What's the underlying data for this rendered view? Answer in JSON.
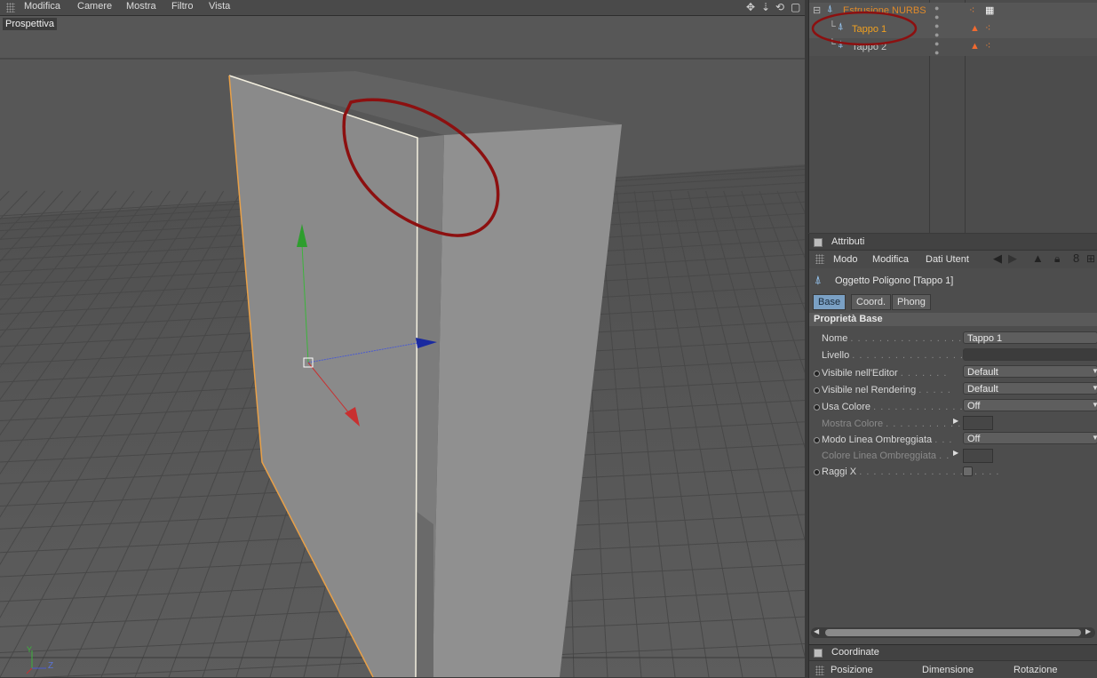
{
  "viewport": {
    "menu": [
      "Modifica",
      "Camere",
      "Mostra",
      "Filtro",
      "Vista"
    ],
    "view_label": "Prospettiva",
    "axis_labels": {
      "y": "Y",
      "z": "Z"
    }
  },
  "object_manager": {
    "objects": [
      {
        "name": "Estrusione NURBS",
        "selected": false,
        "color": "#e08a2a"
      },
      {
        "name": "Tappo 1",
        "selected": true,
        "color": "#f0a020"
      },
      {
        "name": "Tappo 2",
        "selected": false,
        "color": "#c8c8c8"
      }
    ]
  },
  "attributes": {
    "panel_title": "Attributi",
    "menu": [
      "Modo",
      "Modifica",
      "Dati Utent"
    ],
    "object_title": "Oggetto Poligono [Tappo 1]",
    "tabs": [
      "Base",
      "Coord.",
      "Phong"
    ],
    "active_tab": "Base",
    "section_title": "Proprietà Base",
    "rows": [
      {
        "label": "Nome",
        "value": "Tappo 1",
        "type": "text",
        "dim": false
      },
      {
        "label": "Livello",
        "value": "",
        "type": "text",
        "dim": false
      },
      {
        "label": "Visibile nell'Editor",
        "value": "Default",
        "type": "select",
        "dim": false
      },
      {
        "label": "Visibile nel Rendering",
        "value": "Default",
        "type": "select",
        "dim": false
      },
      {
        "label": "Usa Colore",
        "value": "Off",
        "type": "select",
        "dim": false
      },
      {
        "label": "Mostra Colore",
        "value": "",
        "type": "color",
        "dim": true
      },
      {
        "label": "Modo Linea Ombreggiata",
        "value": "Off",
        "type": "select",
        "dim": false
      },
      {
        "label": "Colore Linea Ombreggiata",
        "value": "",
        "type": "color",
        "dim": true
      },
      {
        "label": "Raggi X",
        "value": "",
        "type": "checkbox",
        "dim": false
      }
    ]
  },
  "coordinates": {
    "panel_title": "Coordinate",
    "columns": [
      "Posizione",
      "Dimensione",
      "Rotazione"
    ]
  },
  "colors": {
    "selection_highlight": "#f0a020",
    "annotation_circle": "#8c1010",
    "tab_active": "#7aa0c4"
  }
}
